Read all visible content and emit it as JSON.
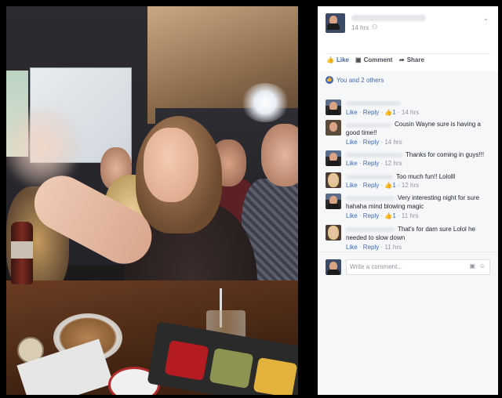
{
  "post": {
    "time": "14 hrs",
    "audience_icon": "friends-icon",
    "menu_icon": "chevron-down-icon"
  },
  "actions": {
    "like": "Like",
    "comment": "Comment",
    "share": "Share"
  },
  "reactions": {
    "summary": "You and 2 others"
  },
  "comments": [
    {
      "text": "",
      "like": "Like",
      "reply": "Reply",
      "likes": "1",
      "time": "14 hrs"
    },
    {
      "text": "Cousin Wayne sure is having a good time!!",
      "like": "Like",
      "reply": "Reply",
      "likes": "",
      "time": "14 hrs"
    },
    {
      "text": "Thanks for coming in guys!!!",
      "like": "Like",
      "reply": "Reply",
      "likes": "",
      "time": "12 hrs"
    },
    {
      "text": "Too much fun!! Lololll",
      "like": "Like",
      "reply": "Reply",
      "likes": "1",
      "time": "12 hrs"
    },
    {
      "text": "Very interesting night for sure hahaha mind blowing magic",
      "like": "Like",
      "reply": "Reply",
      "likes": "1",
      "time": "11 hrs"
    },
    {
      "text": "That's for dam sure Lolol he needed to slow down",
      "like": "Like",
      "reply": "Reply",
      "likes": "",
      "time": "11 hrs"
    }
  ],
  "composer": {
    "placeholder": "Write a comment..."
  },
  "colors": {
    "brand": "#4267b2",
    "meta": "#90949c",
    "panel_bg": "#f6f7f9"
  }
}
